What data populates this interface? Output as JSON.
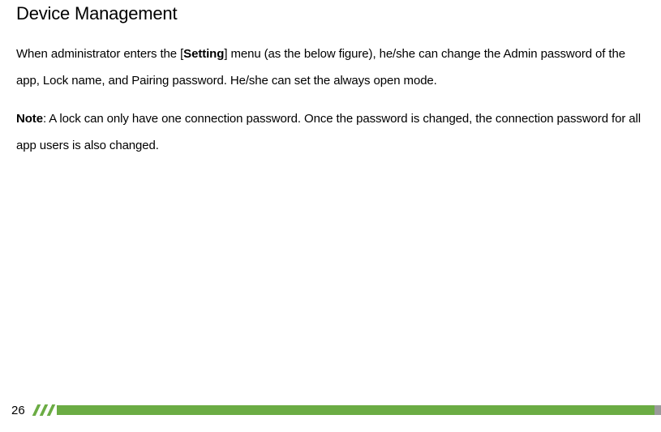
{
  "heading": "Device Management",
  "p1_pre": "When administrator enters the [",
  "p1_bold": "Setting",
  "p1_post": "] menu (as the below figure), he/she can change the Admin password of the app, Lock name, and Pairing password. He/she can set the always open mode.",
  "p2_bold": "Note",
  "p2_post": ": A lock can only have one connection password. Once the password is changed, the connection password for all app users is also changed.",
  "page_number": "26"
}
